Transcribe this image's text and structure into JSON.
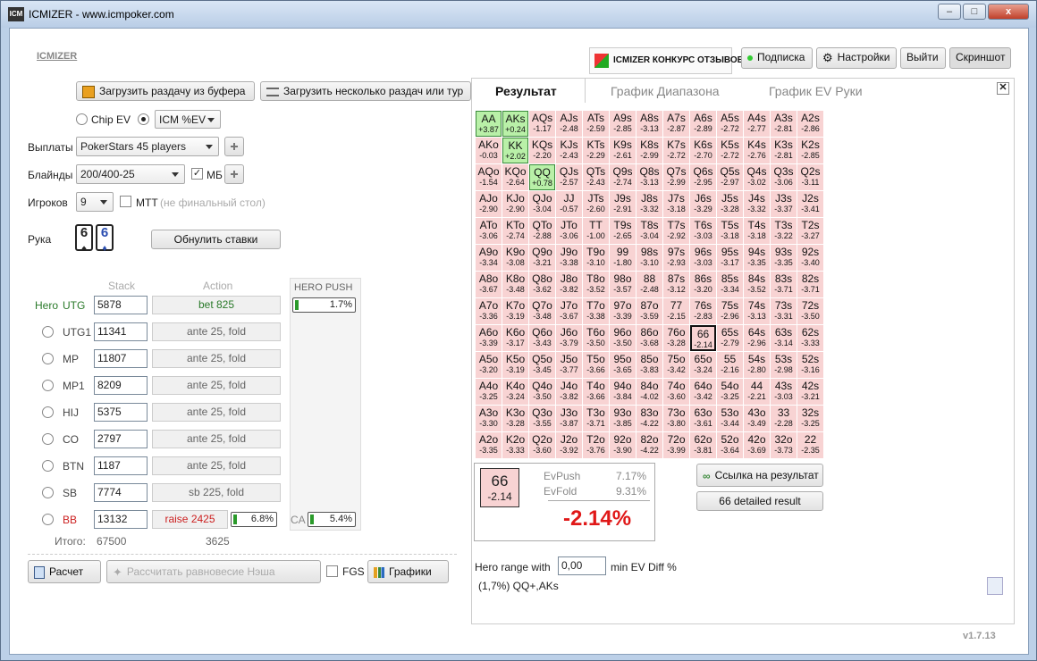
{
  "window": {
    "title": "ICMIZER - www.icmpoker.com",
    "min": "–",
    "max": "□",
    "close": "x"
  },
  "header": {
    "logo": "ICMIZER",
    "banner": "ICMIZER КОНКУРС ОТЗЫВОВ",
    "subscribe": "Подписка",
    "settings": "Настройки",
    "exit": "Выйти",
    "screenshot": "Скриншот"
  },
  "left": {
    "load_hand": "Загрузить раздачу из буфера",
    "load_many": "Загрузить несколько раздач или тур",
    "chip_ev": "Chip EV",
    "icm_select": "ICM %EV",
    "payouts_label": "Выплаты",
    "payouts_value": "PokerStars 45 players",
    "blinds_label": "Блайнды",
    "blinds_value": "200/400-25",
    "mb_label": "МБ",
    "mb_checked": "✓",
    "players_label": "Игроков",
    "players_value": "9",
    "mtt_label": "MTT",
    "mtt_note": "(не финальный стол)",
    "hand_label": "Рука",
    "card1": "6",
    "card1_suit": "♠",
    "card2": "6",
    "card2_suit": "♦",
    "reset_bets": "Обнулить ставки",
    "stack_header": "Stack",
    "action_header": "Action",
    "hero_push_header": "HERO PUSH",
    "hero_label": "Hero",
    "players": [
      {
        "pos": "UTG",
        "stack": "5878",
        "action": "bet 825"
      },
      {
        "pos": "UTG1",
        "stack": "11341",
        "action": "ante 25, fold"
      },
      {
        "pos": "MP",
        "stack": "11807",
        "action": "ante 25, fold"
      },
      {
        "pos": "MP1",
        "stack": "8209",
        "action": "ante 25, fold"
      },
      {
        "pos": "HIJ",
        "stack": "5375",
        "action": "ante 25, fold"
      },
      {
        "pos": "CO",
        "stack": "2797",
        "action": "ante 25, fold"
      },
      {
        "pos": "BTN",
        "stack": "1187",
        "action": "ante 25, fold"
      },
      {
        "pos": "SB",
        "stack": "7774",
        "action": "sb 225, fold"
      },
      {
        "pos": "BB",
        "stack": "13132",
        "action": "raise 2425"
      }
    ],
    "hero_push_pct": "1.7%",
    "bb_pct": "6.8%",
    "ca_label": "CA",
    "ca_pct": "5.4%",
    "total_label": "Итого:",
    "total_stack": "67500",
    "total_action": "3625",
    "calc": "Расчет",
    "nash": "Рассчитать равновесие Нэша",
    "fgs": "FGS",
    "charts": "Графики"
  },
  "right": {
    "tabs": [
      "Результат",
      "График Диапазона",
      "График EV Руки"
    ],
    "grid": [
      [
        "AA",
        "+3.87",
        "AKs",
        "+0.24",
        "AQs",
        "-1.17",
        "AJs",
        "-2.48",
        "ATs",
        "-2.59",
        "A9s",
        "-2.85",
        "A8s",
        "-3.13",
        "A7s",
        "-2.87",
        "A6s",
        "-2.89",
        "A5s",
        "-2.72",
        "A4s",
        "-2.77",
        "A3s",
        "-2.81",
        "A2s",
        "-2.86"
      ],
      [
        "AKo",
        "-0.03",
        "KK",
        "+2.02",
        "KQs",
        "-2.20",
        "KJs",
        "-2.43",
        "KTs",
        "-2.29",
        "K9s",
        "-2.61",
        "K8s",
        "-2.99",
        "K7s",
        "-2.72",
        "K6s",
        "-2.70",
        "K5s",
        "-2.72",
        "K4s",
        "-2.76",
        "K3s",
        "-2.81",
        "K2s",
        "-2.85"
      ],
      [
        "AQo",
        "-1.54",
        "KQo",
        "-2.64",
        "QQ",
        "+0.78",
        "QJs",
        "-2.57",
        "QTs",
        "-2.43",
        "Q9s",
        "-2.74",
        "Q8s",
        "-3.13",
        "Q7s",
        "-2.99",
        "Q6s",
        "-2.95",
        "Q5s",
        "-2.97",
        "Q4s",
        "-3.02",
        "Q3s",
        "-3.06",
        "Q2s",
        "-3.11"
      ],
      [
        "AJo",
        "-2.90",
        "KJo",
        "-2.90",
        "QJo",
        "-3.04",
        "JJ",
        "-0.57",
        "JTs",
        "-2.60",
        "J9s",
        "-2.91",
        "J8s",
        "-3.32",
        "J7s",
        "-3.18",
        "J6s",
        "-3.29",
        "J5s",
        "-3.28",
        "J4s",
        "-3.32",
        "J3s",
        "-3.37",
        "J2s",
        "-3.41"
      ],
      [
        "ATo",
        "-3.06",
        "KTo",
        "-2.74",
        "QTo",
        "-2.88",
        "JTo",
        "-3.06",
        "TT",
        "-1.00",
        "T9s",
        "-2.65",
        "T8s",
        "-3.04",
        "T7s",
        "-2.92",
        "T6s",
        "-3.03",
        "T5s",
        "-3.18",
        "T4s",
        "-3.18",
        "T3s",
        "-3.22",
        "T2s",
        "-3.27"
      ],
      [
        "A9o",
        "-3.34",
        "K9o",
        "-3.08",
        "Q9o",
        "-3.21",
        "J9o",
        "-3.38",
        "T9o",
        "-3.10",
        "99",
        "-1.80",
        "98s",
        "-3.10",
        "97s",
        "-2.93",
        "96s",
        "-3.03",
        "95s",
        "-3.17",
        "94s",
        "-3.35",
        "93s",
        "-3.35",
        "92s",
        "-3.40"
      ],
      [
        "A8o",
        "-3.67",
        "K8o",
        "-3.48",
        "Q8o",
        "-3.62",
        "J8o",
        "-3.82",
        "T8o",
        "-3.52",
        "98o",
        "-3.57",
        "88",
        "-2.48",
        "87s",
        "-3.12",
        "86s",
        "-3.20",
        "85s",
        "-3.34",
        "84s",
        "-3.52",
        "83s",
        "-3.71",
        "82s",
        "-3.71"
      ],
      [
        "A7o",
        "-3.36",
        "K7o",
        "-3.19",
        "Q7o",
        "-3.48",
        "J7o",
        "-3.67",
        "T7o",
        "-3.38",
        "97o",
        "-3.39",
        "87o",
        "-3.59",
        "77",
        "-2.15",
        "76s",
        "-2.83",
        "75s",
        "-2.96",
        "74s",
        "-3.13",
        "73s",
        "-3.31",
        "72s",
        "-3.50"
      ],
      [
        "A6o",
        "-3.39",
        "K6o",
        "-3.17",
        "Q6o",
        "-3.43",
        "J6o",
        "-3.79",
        "T6o",
        "-3.50",
        "96o",
        "-3.50",
        "86o",
        "-3.68",
        "76o",
        "-3.28",
        "66",
        "-2.14",
        "65s",
        "-2.79",
        "64s",
        "-2.96",
        "63s",
        "-3.14",
        "62s",
        "-3.33"
      ],
      [
        "A5o",
        "-3.20",
        "K5o",
        "-3.19",
        "Q5o",
        "-3.45",
        "J5o",
        "-3.77",
        "T5o",
        "-3.66",
        "95o",
        "-3.65",
        "85o",
        "-3.83",
        "75o",
        "-3.42",
        "65o",
        "-3.24",
        "55",
        "-2.16",
        "54s",
        "-2.80",
        "53s",
        "-2.98",
        "52s",
        "-3.16"
      ],
      [
        "A4o",
        "-3.25",
        "K4o",
        "-3.24",
        "Q4o",
        "-3.50",
        "J4o",
        "-3.82",
        "T4o",
        "-3.66",
        "94o",
        "-3.84",
        "84o",
        "-4.02",
        "74o",
        "-3.60",
        "64o",
        "-3.42",
        "54o",
        "-3.25",
        "44",
        "-2.21",
        "43s",
        "-3.03",
        "42s",
        "-3.21"
      ],
      [
        "A3o",
        "-3.30",
        "K3o",
        "-3.28",
        "Q3o",
        "-3.55",
        "J3o",
        "-3.87",
        "T3o",
        "-3.71",
        "93o",
        "-3.85",
        "83o",
        "-4.22",
        "73o",
        "-3.80",
        "63o",
        "-3.61",
        "53o",
        "-3.44",
        "43o",
        "-3.49",
        "33",
        "-2.28",
        "32s",
        "-3.25"
      ],
      [
        "A2o",
        "-3.35",
        "K2o",
        "-3.33",
        "Q2o",
        "-3.60",
        "J2o",
        "-3.92",
        "T2o",
        "-3.76",
        "92o",
        "-3.90",
        "82o",
        "-4.22",
        "72o",
        "-3.99",
        "62o",
        "-3.81",
        "52o",
        "-3.64",
        "42o",
        "-3.69",
        "32o",
        "-3.73",
        "22",
        "-2.35"
      ]
    ],
    "push_hands": [
      "AA",
      "AKs",
      "KK",
      "QQ"
    ],
    "selected_hand": "66",
    "detail": {
      "hand": "66",
      "diff": "-2.14",
      "evpush_label": "EvPush",
      "evpush": "7.17%",
      "evfold_label": "EvFold",
      "evfold": "9.31%",
      "result": "-2.14%"
    },
    "link": "Ссылка на результат",
    "detailed": "66 detailed result",
    "hero_range_label": "Hero range with",
    "hero_range_value": "0,00",
    "hero_range_unit": "min EV Diff %",
    "range_text": "(1,7%) QQ+,AKs"
  },
  "version": "v1.7.13",
  "colors": {
    "push": "#b9f0a8",
    "fold": "#f8d3d3",
    "pos_green": "#2a7a2a",
    "bb_red": "#cc2020",
    "result_red": "#e01818"
  }
}
